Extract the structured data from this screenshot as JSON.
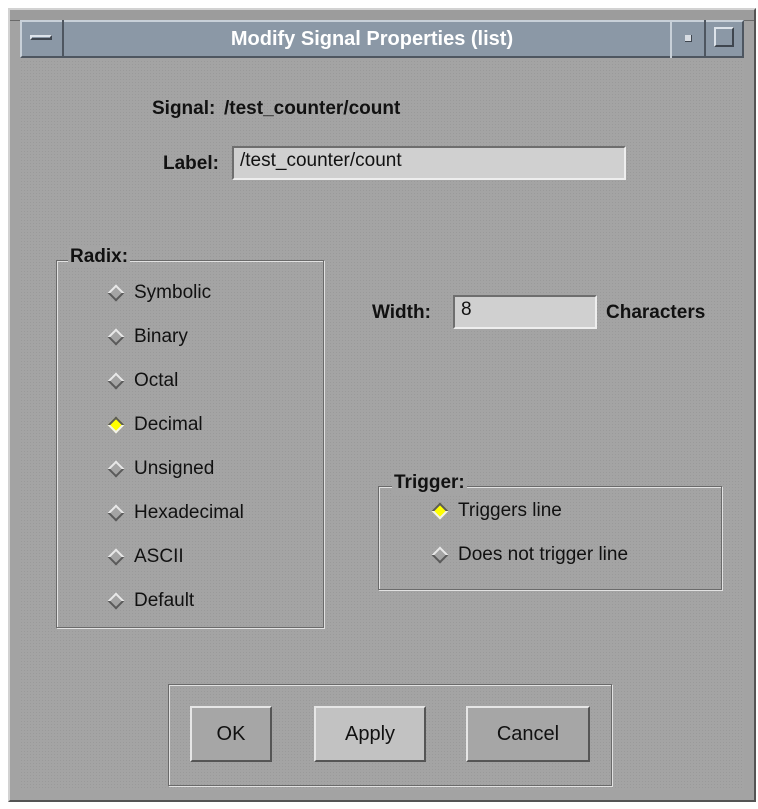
{
  "window": {
    "title": "Modify Signal Properties (list)"
  },
  "signal": {
    "label": "Signal:",
    "value": "/test_counter/count"
  },
  "label_field": {
    "label": "Label:",
    "value": "/test_counter/count"
  },
  "radix": {
    "title": "Radix:",
    "options": [
      "Symbolic",
      "Binary",
      "Octal",
      "Decimal",
      "Unsigned",
      "Hexadecimal",
      "ASCII",
      "Default"
    ],
    "selected": "Decimal"
  },
  "width": {
    "label": "Width:",
    "value": "8",
    "units": "Characters"
  },
  "trigger": {
    "title": "Trigger:",
    "options": [
      "Triggers line",
      "Does not trigger line"
    ],
    "selected": "Triggers line"
  },
  "buttons": {
    "ok": "OK",
    "apply": "Apply",
    "cancel": "Cancel"
  },
  "colors": {
    "titlebar": "#8b98a6",
    "background": "#a4a4a4",
    "radio_selected": "#ffff00"
  }
}
